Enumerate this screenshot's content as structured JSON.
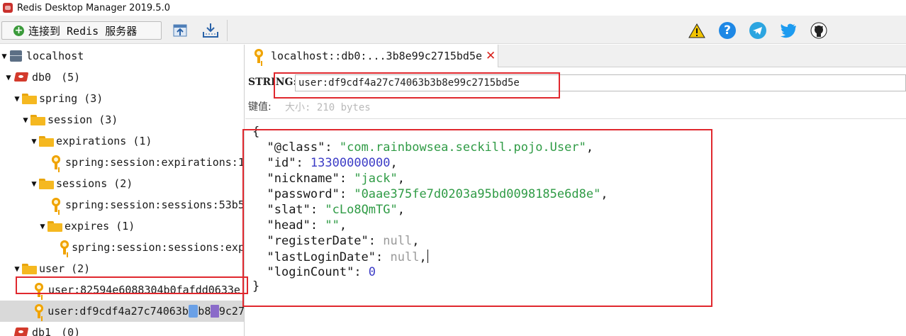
{
  "window": {
    "title": "Redis Desktop Manager 2019.5.0"
  },
  "toolbar": {
    "connect_label": "连接到 Redis 服务器",
    "icons": [
      "import-icon",
      "export-icon",
      "warning-icon",
      "help-icon",
      "telegram-icon",
      "twitter-icon",
      "github-icon"
    ]
  },
  "tree": {
    "server": "localhost",
    "db0": {
      "name": "db0",
      "count": "(5)"
    },
    "spring": {
      "name": "spring",
      "count": "(3)"
    },
    "session": {
      "name": "session",
      "count": "(3)"
    },
    "expirations": {
      "name": "expirations",
      "count": "(1)"
    },
    "expirations_key": "spring:session:expirations:1",
    "sessions": {
      "name": "sessions",
      "count": "(2)"
    },
    "sessions_key": "spring:session:sessions:53b5",
    "expires": {
      "name": "expires",
      "count": "(1)"
    },
    "expires_key": "spring:session:sessions:exp",
    "user": {
      "name": "user",
      "count": "(2)"
    },
    "user_key_1": "user:82594e6088304b0fafdd0633e",
    "user_key_2": "user:df9cdf4a27c74063b",
    "user_key_2_tail": "b8",
    "user_key_2_tail2": "9c27",
    "db1": {
      "name": "db1",
      "count": "(0)"
    }
  },
  "tab": {
    "label": "localhost::db0:...3b8e99c2715bd5e",
    "close": "✕"
  },
  "key_view": {
    "type_label": "STRING:",
    "key_value": "user:df9cdf4a27c74063b3b8e99c2715bd5e",
    "value_label": "键值:",
    "size_label": "大小: 210 bytes"
  },
  "value_json": {
    "open": "{",
    "close": "}",
    "fields": [
      {
        "key": "\"@class\"",
        "value": "\"com.rainbowsea.seckill.pojo.User\"",
        "kind": "string",
        "comma": ","
      },
      {
        "key": "\"id\"",
        "value": "13300000000",
        "kind": "number",
        "comma": ","
      },
      {
        "key": "\"nickname\"",
        "value": "\"jack\"",
        "kind": "string",
        "comma": ","
      },
      {
        "key": "\"password\"",
        "value": "\"0aae375fe7d0203a95bd0098185e6d8e\"",
        "kind": "string",
        "comma": ","
      },
      {
        "key": "\"slat\"",
        "value": "\"cLo8QmTG\"",
        "kind": "string",
        "comma": ","
      },
      {
        "key": "\"head\"",
        "value": "\"\"",
        "kind": "string",
        "comma": ","
      },
      {
        "key": "\"registerDate\"",
        "value": "null",
        "kind": "null",
        "comma": ","
      },
      {
        "key": "\"lastLoginDate\"",
        "value": "null",
        "kind": "null",
        "comma": ","
      },
      {
        "key": "\"loginCount\"",
        "value": "0",
        "kind": "number",
        "comma": ""
      }
    ]
  },
  "colors": {
    "annotation_red": "#e0282e",
    "string_green": "#2f9b45",
    "number_blue": "#3c3cc6",
    "null_gray": "#9a9a9a",
    "folder_yellow": "#f5b820",
    "key_orange": "#f0a300"
  }
}
